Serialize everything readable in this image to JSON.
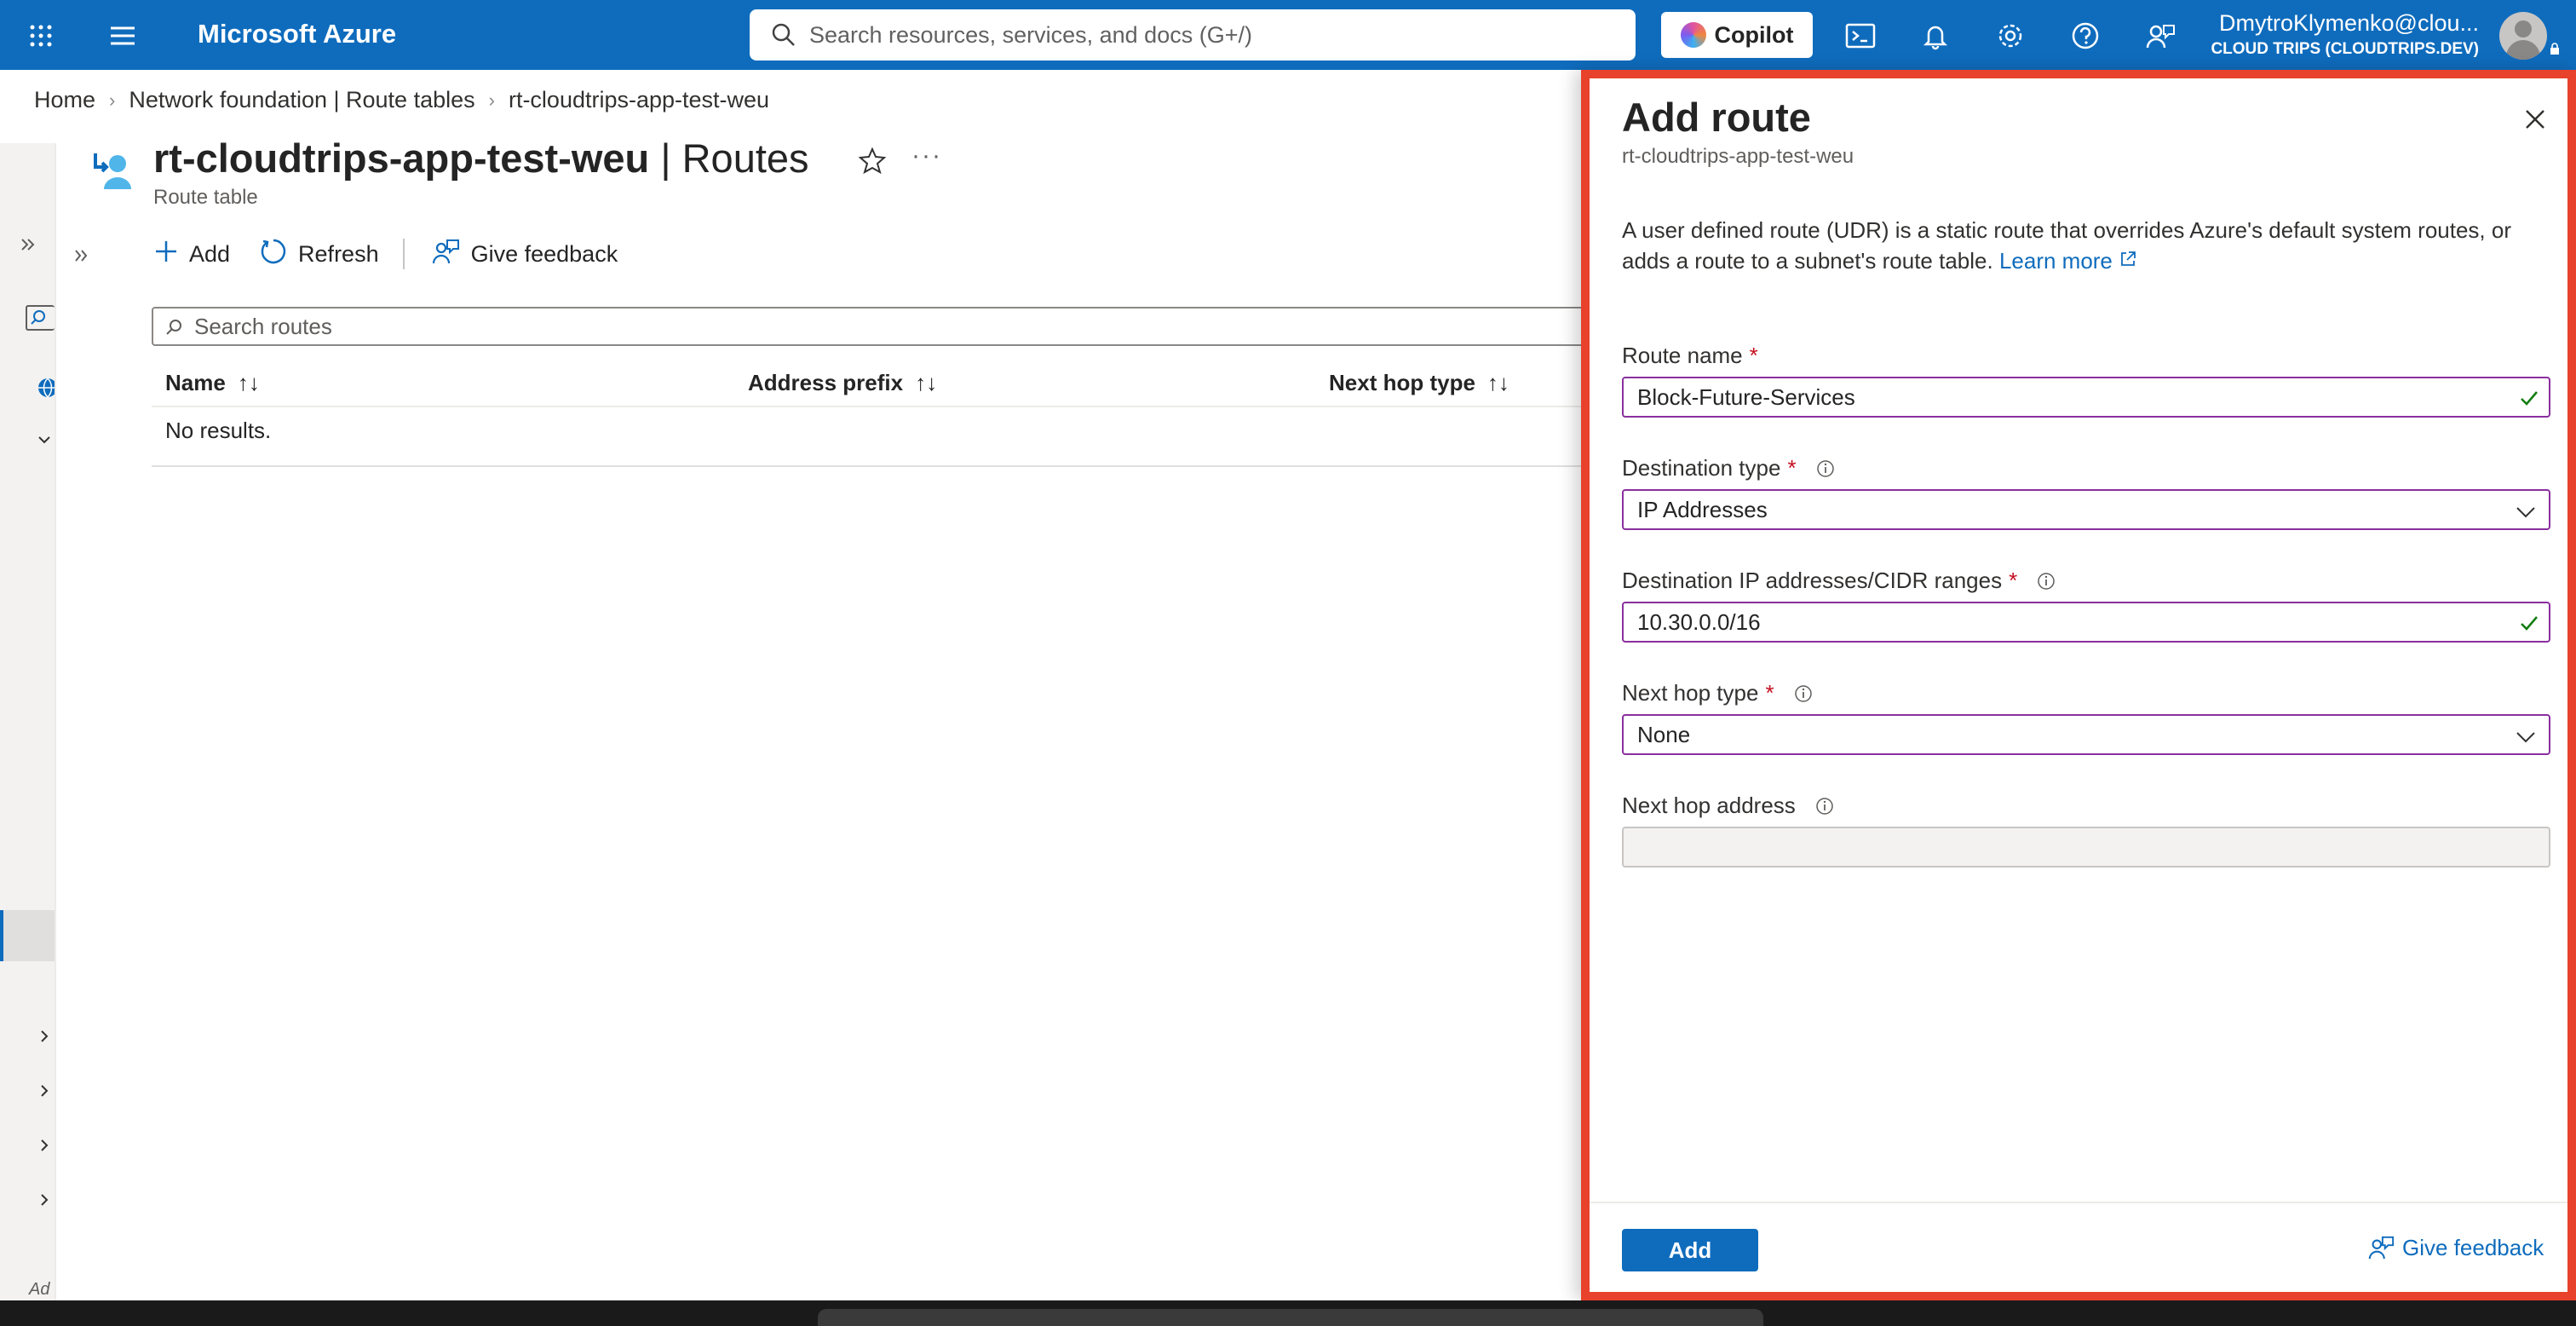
{
  "topbar": {
    "brand": "Microsoft Azure",
    "search_placeholder": "Search resources, services, and docs (G+/)",
    "copilot_label": "Copilot",
    "account_email": "DmytroKlymenko@clou...",
    "account_tenant": "CLOUD TRIPS (CLOUDTRIPS.DEV)",
    "accent_color": "#0f6cbd"
  },
  "breadcrumb": {
    "items": [
      "Home",
      "Network foundation | Route tables",
      "rt-cloudtrips-app-test-weu"
    ]
  },
  "resource": {
    "name": "rt-cloudtrips-app-test-weu",
    "section": "| Routes",
    "type": "Route table"
  },
  "toolbar": {
    "add_label": "Add",
    "refresh_label": "Refresh",
    "feedback_label": "Give feedback"
  },
  "grid": {
    "search_placeholder": "Search routes",
    "columns": [
      "Name",
      "Address prefix",
      "Next hop type"
    ],
    "empty_text": "No results."
  },
  "leftnav": {
    "bottom_text": "Ad"
  },
  "panel": {
    "title": "Add route",
    "subtitle": "rt-cloudtrips-app-test-weu",
    "description": "A user defined route (UDR) is a static route that overrides Azure's default system routes, or adds a route to a subnet's route table.",
    "learn_more": "Learn more",
    "fields": {
      "route_name": {
        "label": "Route name",
        "value": "Block-Future-Services"
      },
      "destination_type": {
        "label": "Destination type",
        "value": "IP Addresses"
      },
      "destination_ips": {
        "label": "Destination IP addresses/CIDR ranges",
        "value": "10.30.0.0/16"
      },
      "next_hop_type": {
        "label": "Next hop type",
        "value": "None"
      },
      "next_hop_address": {
        "label": "Next hop address",
        "value": ""
      }
    },
    "add_button": "Add",
    "feedback": "Give feedback",
    "highlight_color": "#e8412c"
  }
}
